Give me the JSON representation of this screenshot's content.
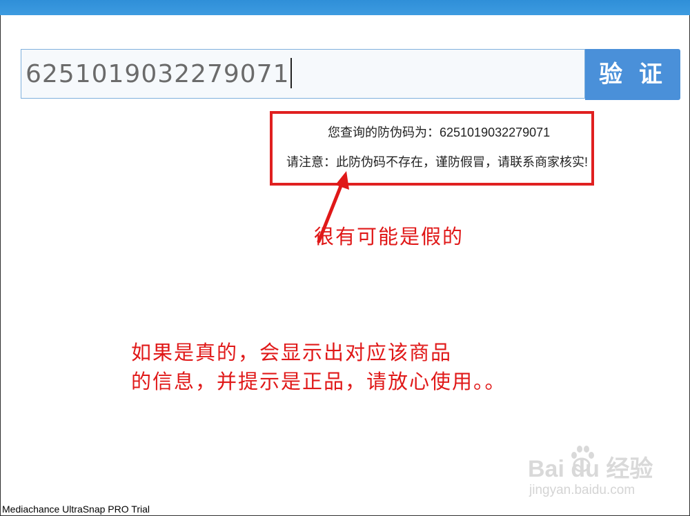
{
  "search": {
    "value": "6251019032279071",
    "verify_label": "验 证"
  },
  "result": {
    "line1": "您查询的防伪码为：6251019032279071",
    "line2": "请注意：此防伪码不存在，谨防假冒，请联系商家核实!"
  },
  "annotations": {
    "fake_note": "很有可能是假的",
    "real_note_line1": "如果是真的，会显示出对应该商品",
    "real_note_line2": "的信息，并提示是正品，请放心使用。。"
  },
  "watermark": {
    "brand": "Bai du 经验",
    "url": "jingyan.baidu.com"
  },
  "footer": {
    "trial_text": "Mediachance UltraSnap PRO Trial"
  },
  "colors": {
    "top_bar": "#3b97de",
    "button": "#4a90d9",
    "annotation_red": "#e01818",
    "input_border": "#7fb0dd"
  }
}
